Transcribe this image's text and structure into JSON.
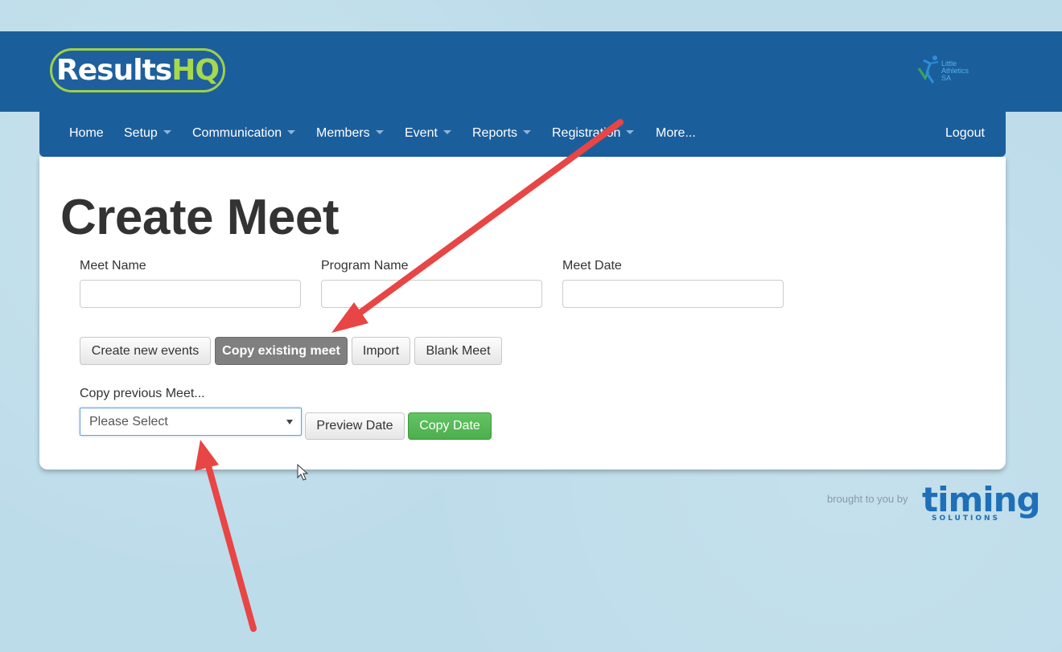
{
  "header": {
    "logo_text_white": "Results",
    "logo_text_green": "HQ",
    "org_logo_text": "Little Athletics SA"
  },
  "nav": {
    "items": [
      {
        "label": "Home",
        "has_caret": false
      },
      {
        "label": "Setup",
        "has_caret": true
      },
      {
        "label": "Communication",
        "has_caret": true
      },
      {
        "label": "Members",
        "has_caret": true
      },
      {
        "label": "Event",
        "has_caret": true
      },
      {
        "label": "Reports",
        "has_caret": true
      },
      {
        "label": "Registration",
        "has_caret": true
      },
      {
        "label": "More...",
        "has_caret": false
      }
    ],
    "logout_label": "Logout"
  },
  "main": {
    "title": "Create Meet",
    "fields": {
      "meet_name_label": "Meet Name",
      "meet_name_value": "",
      "program_name_label": "Program Name",
      "program_name_value": "",
      "meet_date_label": "Meet Date",
      "meet_date_value": ""
    },
    "mode_buttons": {
      "create_new_events": "Create new events",
      "copy_existing_meet": "Copy existing meet",
      "import": "Import",
      "blank_meet": "Blank Meet",
      "active": "copy_existing_meet"
    },
    "copy_section": {
      "label": "Copy previous Meet...",
      "select_value": "Please Select",
      "preview_button": "Preview Date",
      "copy_button": "Copy Date"
    }
  },
  "footer": {
    "brought_text": "brought to you by",
    "brand_word": "timing",
    "brand_sub": "SOLUTIONS"
  },
  "colors": {
    "header_bg": "#1b5e9c",
    "page_bg": "#bddcea",
    "logo_green": "#a6d94b",
    "active_button": "#808080",
    "success_button": "#5cb85c",
    "annotation_arrow": "#e84545"
  }
}
